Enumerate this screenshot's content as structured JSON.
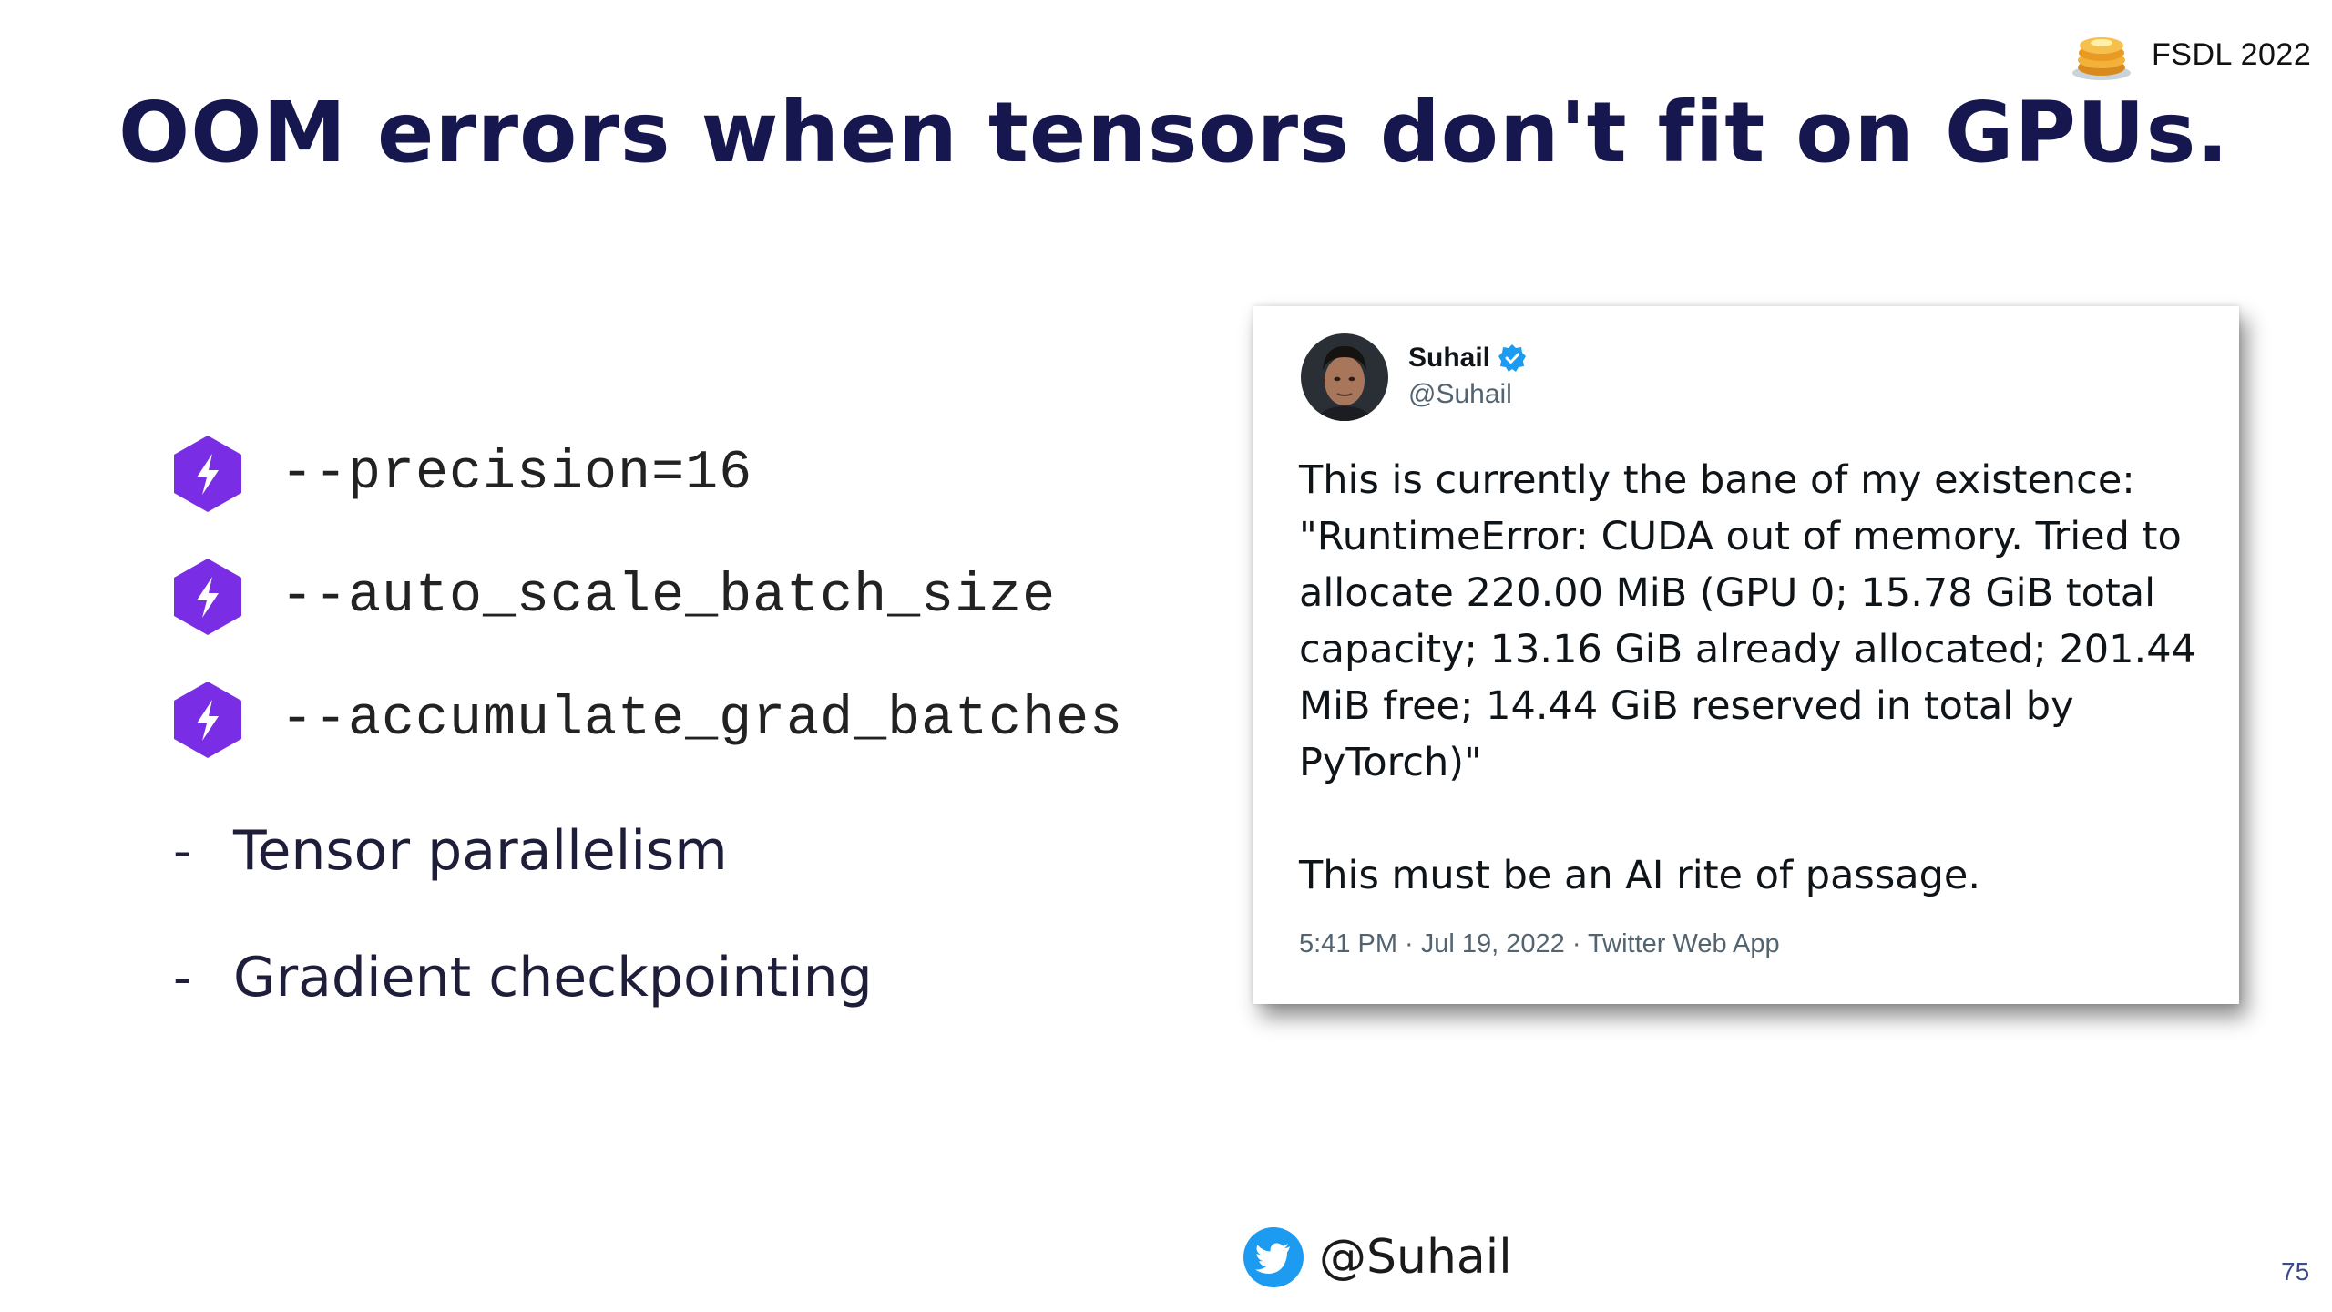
{
  "header": {
    "badge_text": "FSDL 2022",
    "badge_icon": "pancake-stack-icon"
  },
  "title": "OOM errors when tensors don't fit on GPUs.",
  "flags": [
    {
      "text": "--precision=16",
      "icon": "lightning-hexagon-icon"
    },
    {
      "text": "--auto_scale_batch_size",
      "icon": "lightning-hexagon-icon"
    },
    {
      "text": "--accumulate_grad_batches",
      "icon": "lightning-hexagon-icon"
    }
  ],
  "bullets": [
    {
      "marker": "-",
      "text": "Tensor parallelism"
    },
    {
      "marker": "-",
      "text": "Gradient checkpointing"
    }
  ],
  "tweet": {
    "name": "Suhail",
    "handle": "@Suhail",
    "verified": true,
    "paragraphs": [
      "This is currently the bane of my existence: \"RuntimeError: CUDA out of memory. Tried to allocate 220.00 MiB (GPU 0; 15.78 GiB total capacity; 13.16 GiB already allocated; 201.44 MiB free; 14.44 GiB reserved in total by PyTorch)\"",
      "This must be an AI rite of passage."
    ],
    "meta": "5:41 PM · Jul 19, 2022 · Twitter Web App"
  },
  "footer": {
    "handle": "@Suhail",
    "icon": "twitter-bird-icon"
  },
  "page_number": "75",
  "colors": {
    "title": "#17174f",
    "lightning_purple": "#792ee5",
    "twitter_blue": "#1d9bf0",
    "verified_blue": "#1d9bf0",
    "page_number": "#3b4a8c"
  }
}
